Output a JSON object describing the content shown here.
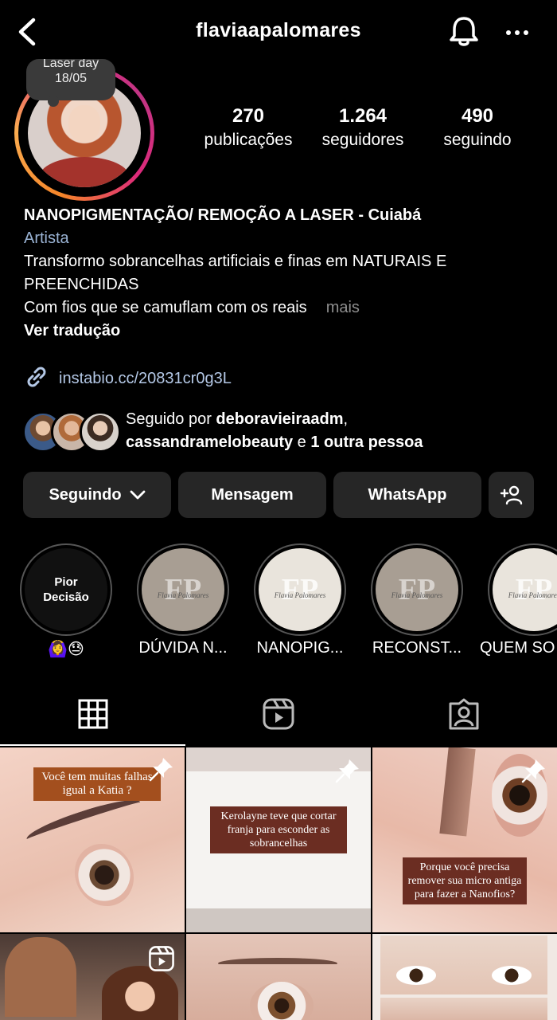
{
  "header": {
    "username": "flaviaapalomares"
  },
  "profile": {
    "note_line1": "Laser day",
    "note_line2": "18/05",
    "stats": [
      {
        "value": "270",
        "label": "publicações"
      },
      {
        "value": "1.264",
        "label": "seguidores"
      },
      {
        "value": "490",
        "label": "seguindo"
      }
    ],
    "bio_name": "NANOPIGMENTAÇÃO/ REMOÇÃO A LASER - Cuiabá",
    "category": "Artista",
    "bio_line1": "Transformo sobrancelhas artificiais e finas em NATURAIS E PREENCHIDAS",
    "bio_line2": "Com fios que se camuflam com os reais",
    "more": "mais",
    "translate": "Ver tradução",
    "link": "instabio.cc/20831cr0g3L",
    "followed_prefix": "Seguido por ",
    "followed_user1": "deboravieiraadm",
    "followed_sep": ",",
    "followed_user2": "cassandramelobeauty",
    "followed_mid": " e ",
    "followed_others": "1 outra pessoa"
  },
  "buttons": {
    "following": "Seguindo",
    "message": "Mensagem",
    "whatsapp": "WhatsApp"
  },
  "highlights": [
    {
      "cover_text": "Pior Decisão",
      "label": "🙆‍♀️😓"
    },
    {
      "cover_text": "FP",
      "cover_sub": "Flavia Palomares",
      "label": "DÚVIDA N..."
    },
    {
      "cover_text": "FP",
      "cover_sub": "Flavia Palomares",
      "label": "NANOPIG..."
    },
    {
      "cover_text": "FP",
      "cover_sub": "Flavia Palomares",
      "label": "RECONST..."
    },
    {
      "cover_text": "FP",
      "cover_sub": "Flavia Palomares",
      "label": "QUEM SO"
    }
  ],
  "posts": [
    {
      "caption": "Você tem muitas falhas igual a Katia ?",
      "pinned": true
    },
    {
      "caption": "Kerolayne teve que cortar franja para esconder as sobrancelhas",
      "pinned": true
    },
    {
      "caption": "Porque você precisa remover sua micro antiga para fazer a Nanofios?",
      "pinned": true
    },
    {
      "caption": "",
      "reel": true
    },
    {
      "caption": ""
    },
    {
      "caption": ""
    }
  ],
  "colors": {
    "background": "#000000",
    "button_bg": "#262626",
    "link": "#b4c8e6",
    "category": "#9ab3d4",
    "muted": "#8e8e8e"
  }
}
